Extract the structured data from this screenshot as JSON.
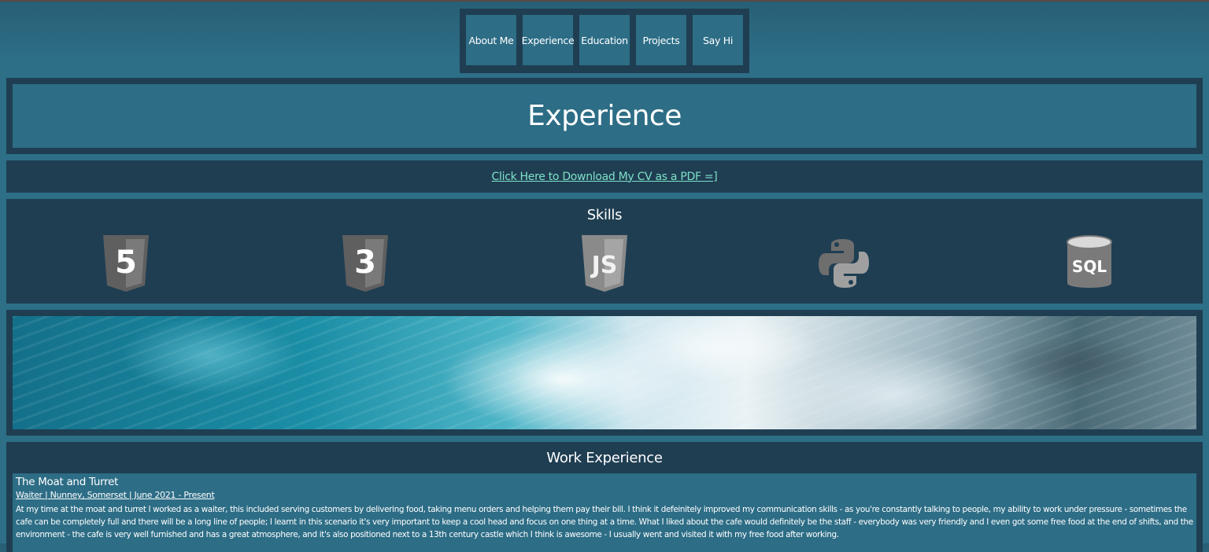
{
  "nav": {
    "items": [
      {
        "label": "About Me"
      },
      {
        "label": "Experience"
      },
      {
        "label": "Education"
      },
      {
        "label": "Projects"
      },
      {
        "label": "Say Hi"
      }
    ]
  },
  "page_title": "Experience",
  "cv_link": "Click Here to Download My CV as a PDF =]",
  "skills": {
    "title": "Skills",
    "icons": [
      {
        "icon": "html5-icon",
        "text": "5"
      },
      {
        "icon": "css3-icon",
        "text": "3"
      },
      {
        "icon": "javascript-icon",
        "text": "JS"
      },
      {
        "icon": "python-icon"
      },
      {
        "icon": "sql-icon",
        "text": "SQL"
      }
    ]
  },
  "work": {
    "title": "Work Experience",
    "jobs": [
      {
        "name": "The Moat and Turret",
        "subtitle": "Waiter | Nunney, Somerset | June 2021 - Present",
        "description": "At my time at the moat and turret I worked as a waiter, this included serving customers by delivering food, taking menu orders and helping them pay their bill. I think it defeinitely improved my communication skills - as you're constantly talking to people, my ability to work under pressure - sometimes the cafe can be completely full and there will be a long line of people; I learnt in this scenario it's very important to keep a cool head and focus on one thing at a time. What I liked about the cafe would definitely be the staff - everybody was very friendly and I even got some free food at the end of shifts, and the environment - the cafe is very well furnished and has a great atmosphere, and it's also positioned next to a 13th century castle which I think is awesome - I usually went and visited it with my free food after working."
      }
    ]
  },
  "colors": {
    "dark_panel": "#1f3e52",
    "light_panel": "#2d6d86",
    "link": "#7ee0c8",
    "icon_grey": "#6e6e6e"
  }
}
